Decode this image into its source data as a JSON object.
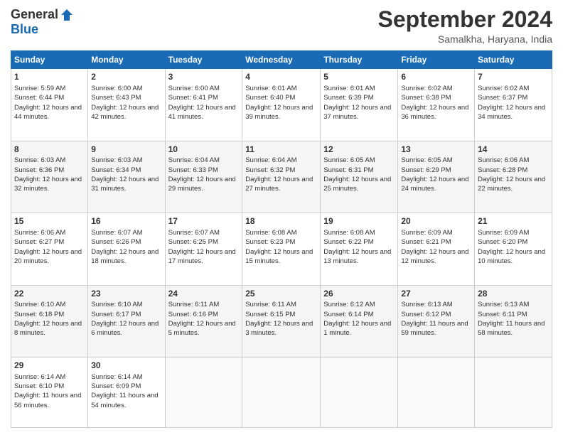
{
  "logo": {
    "general": "General",
    "blue": "Blue"
  },
  "title": "September 2024",
  "location": "Samalkha, Haryana, India",
  "days_header": [
    "Sunday",
    "Monday",
    "Tuesday",
    "Wednesday",
    "Thursday",
    "Friday",
    "Saturday"
  ],
  "weeks": [
    [
      {
        "day": "1",
        "sunrise": "Sunrise: 5:59 AM",
        "sunset": "Sunset: 6:44 PM",
        "daylight": "Daylight: 12 hours and 44 minutes."
      },
      {
        "day": "2",
        "sunrise": "Sunrise: 6:00 AM",
        "sunset": "Sunset: 6:43 PM",
        "daylight": "Daylight: 12 hours and 42 minutes."
      },
      {
        "day": "3",
        "sunrise": "Sunrise: 6:00 AM",
        "sunset": "Sunset: 6:41 PM",
        "daylight": "Daylight: 12 hours and 41 minutes."
      },
      {
        "day": "4",
        "sunrise": "Sunrise: 6:01 AM",
        "sunset": "Sunset: 6:40 PM",
        "daylight": "Daylight: 12 hours and 39 minutes."
      },
      {
        "day": "5",
        "sunrise": "Sunrise: 6:01 AM",
        "sunset": "Sunset: 6:39 PM",
        "daylight": "Daylight: 12 hours and 37 minutes."
      },
      {
        "day": "6",
        "sunrise": "Sunrise: 6:02 AM",
        "sunset": "Sunset: 6:38 PM",
        "daylight": "Daylight: 12 hours and 36 minutes."
      },
      {
        "day": "7",
        "sunrise": "Sunrise: 6:02 AM",
        "sunset": "Sunset: 6:37 PM",
        "daylight": "Daylight: 12 hours and 34 minutes."
      }
    ],
    [
      {
        "day": "8",
        "sunrise": "Sunrise: 6:03 AM",
        "sunset": "Sunset: 6:36 PM",
        "daylight": "Daylight: 12 hours and 32 minutes."
      },
      {
        "day": "9",
        "sunrise": "Sunrise: 6:03 AM",
        "sunset": "Sunset: 6:34 PM",
        "daylight": "Daylight: 12 hours and 31 minutes."
      },
      {
        "day": "10",
        "sunrise": "Sunrise: 6:04 AM",
        "sunset": "Sunset: 6:33 PM",
        "daylight": "Daylight: 12 hours and 29 minutes."
      },
      {
        "day": "11",
        "sunrise": "Sunrise: 6:04 AM",
        "sunset": "Sunset: 6:32 PM",
        "daylight": "Daylight: 12 hours and 27 minutes."
      },
      {
        "day": "12",
        "sunrise": "Sunrise: 6:05 AM",
        "sunset": "Sunset: 6:31 PM",
        "daylight": "Daylight: 12 hours and 25 minutes."
      },
      {
        "day": "13",
        "sunrise": "Sunrise: 6:05 AM",
        "sunset": "Sunset: 6:29 PM",
        "daylight": "Daylight: 12 hours and 24 minutes."
      },
      {
        "day": "14",
        "sunrise": "Sunrise: 6:06 AM",
        "sunset": "Sunset: 6:28 PM",
        "daylight": "Daylight: 12 hours and 22 minutes."
      }
    ],
    [
      {
        "day": "15",
        "sunrise": "Sunrise: 6:06 AM",
        "sunset": "Sunset: 6:27 PM",
        "daylight": "Daylight: 12 hours and 20 minutes."
      },
      {
        "day": "16",
        "sunrise": "Sunrise: 6:07 AM",
        "sunset": "Sunset: 6:26 PM",
        "daylight": "Daylight: 12 hours and 18 minutes."
      },
      {
        "day": "17",
        "sunrise": "Sunrise: 6:07 AM",
        "sunset": "Sunset: 6:25 PM",
        "daylight": "Daylight: 12 hours and 17 minutes."
      },
      {
        "day": "18",
        "sunrise": "Sunrise: 6:08 AM",
        "sunset": "Sunset: 6:23 PM",
        "daylight": "Daylight: 12 hours and 15 minutes."
      },
      {
        "day": "19",
        "sunrise": "Sunrise: 6:08 AM",
        "sunset": "Sunset: 6:22 PM",
        "daylight": "Daylight: 12 hours and 13 minutes."
      },
      {
        "day": "20",
        "sunrise": "Sunrise: 6:09 AM",
        "sunset": "Sunset: 6:21 PM",
        "daylight": "Daylight: 12 hours and 12 minutes."
      },
      {
        "day": "21",
        "sunrise": "Sunrise: 6:09 AM",
        "sunset": "Sunset: 6:20 PM",
        "daylight": "Daylight: 12 hours and 10 minutes."
      }
    ],
    [
      {
        "day": "22",
        "sunrise": "Sunrise: 6:10 AM",
        "sunset": "Sunset: 6:18 PM",
        "daylight": "Daylight: 12 hours and 8 minutes."
      },
      {
        "day": "23",
        "sunrise": "Sunrise: 6:10 AM",
        "sunset": "Sunset: 6:17 PM",
        "daylight": "Daylight: 12 hours and 6 minutes."
      },
      {
        "day": "24",
        "sunrise": "Sunrise: 6:11 AM",
        "sunset": "Sunset: 6:16 PM",
        "daylight": "Daylight: 12 hours and 5 minutes."
      },
      {
        "day": "25",
        "sunrise": "Sunrise: 6:11 AM",
        "sunset": "Sunset: 6:15 PM",
        "daylight": "Daylight: 12 hours and 3 minutes."
      },
      {
        "day": "26",
        "sunrise": "Sunrise: 6:12 AM",
        "sunset": "Sunset: 6:14 PM",
        "daylight": "Daylight: 12 hours and 1 minute."
      },
      {
        "day": "27",
        "sunrise": "Sunrise: 6:13 AM",
        "sunset": "Sunset: 6:12 PM",
        "daylight": "Daylight: 11 hours and 59 minutes."
      },
      {
        "day": "28",
        "sunrise": "Sunrise: 6:13 AM",
        "sunset": "Sunset: 6:11 PM",
        "daylight": "Daylight: 11 hours and 58 minutes."
      }
    ],
    [
      {
        "day": "29",
        "sunrise": "Sunrise: 6:14 AM",
        "sunset": "Sunset: 6:10 PM",
        "daylight": "Daylight: 11 hours and 56 minutes."
      },
      {
        "day": "30",
        "sunrise": "Sunrise: 6:14 AM",
        "sunset": "Sunset: 6:09 PM",
        "daylight": "Daylight: 11 hours and 54 minutes."
      },
      null,
      null,
      null,
      null,
      null
    ]
  ]
}
